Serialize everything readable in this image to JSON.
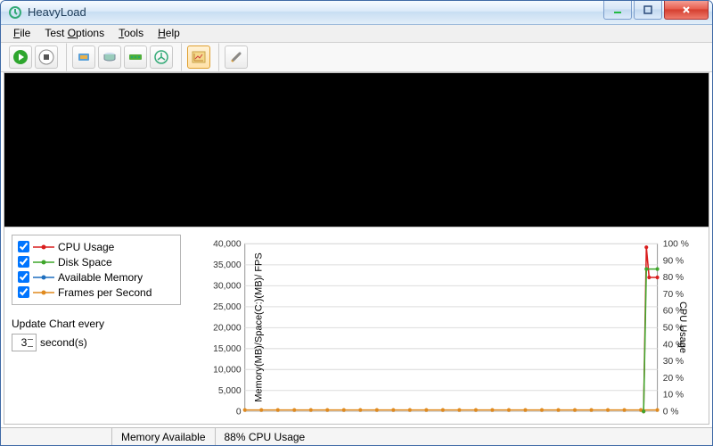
{
  "window": {
    "title": "HeavyLoad"
  },
  "menu": {
    "file": "File",
    "test_options": "Test Options",
    "tools": "Tools",
    "help": "Help"
  },
  "toolbar": {
    "start": "Start",
    "stop": "Stop",
    "cpu": "CPU load",
    "disk": "Disk load",
    "mem": "Memory load",
    "fan": "Treesize/Scan",
    "chart": "Chart view",
    "settings": "Settings"
  },
  "legend": {
    "items": [
      {
        "label": "CPU Usage",
        "color": "#d91e1e"
      },
      {
        "label": "Disk Space",
        "color": "#3fa62a"
      },
      {
        "label": "Available Memory",
        "color": "#1f6fbf"
      },
      {
        "label": "Frames per Second",
        "color": "#e08a1e"
      }
    ]
  },
  "update": {
    "label": "Update Chart every",
    "value": "3",
    "unit": "second(s)"
  },
  "axes": {
    "left_label": "Memory(MB)/Space(C:)(MB)/ FPS",
    "right_label": "CPU Usage",
    "left_ticks": [
      "0",
      "5,000",
      "10,000",
      "15,000",
      "20,000",
      "25,000",
      "30,000",
      "35,000",
      "40,000"
    ],
    "right_ticks": [
      "0 %",
      "10 %",
      "20 %",
      "30 %",
      "40 %",
      "50 %",
      "60 %",
      "70 %",
      "80 %",
      "90 %",
      "100 %"
    ]
  },
  "status": {
    "mem": "Memory Available",
    "cpu": "88% CPU Usage"
  },
  "chart_data": {
    "type": "line",
    "x_range_seconds": [
      0,
      300
    ],
    "left_axis": {
      "label": "Memory(MB)/Space(C:)(MB)/FPS",
      "range": [
        0,
        45000
      ]
    },
    "right_axis": {
      "label": "CPU Usage",
      "range": [
        0,
        100
      ]
    },
    "series": [
      {
        "name": "CPU Usage",
        "axis": "right",
        "color": "#d91e1e",
        "points": [
          [
            290,
            0
          ],
          [
            292,
            98
          ],
          [
            294,
            80
          ],
          [
            300,
            80
          ]
        ]
      },
      {
        "name": "Disk Space",
        "axis": "right",
        "color": "#3fa62a",
        "points": [
          [
            290,
            0
          ],
          [
            292,
            85
          ],
          [
            300,
            85
          ]
        ]
      },
      {
        "name": "Available Memory",
        "axis": "left",
        "color": "#1f6fbf",
        "points": [
          [
            0,
            500
          ],
          [
            300,
            500
          ]
        ]
      },
      {
        "name": "Frames per Second",
        "axis": "left",
        "color": "#e08a1e",
        "points": [
          [
            0,
            400
          ],
          [
            300,
            400
          ]
        ]
      }
    ]
  }
}
